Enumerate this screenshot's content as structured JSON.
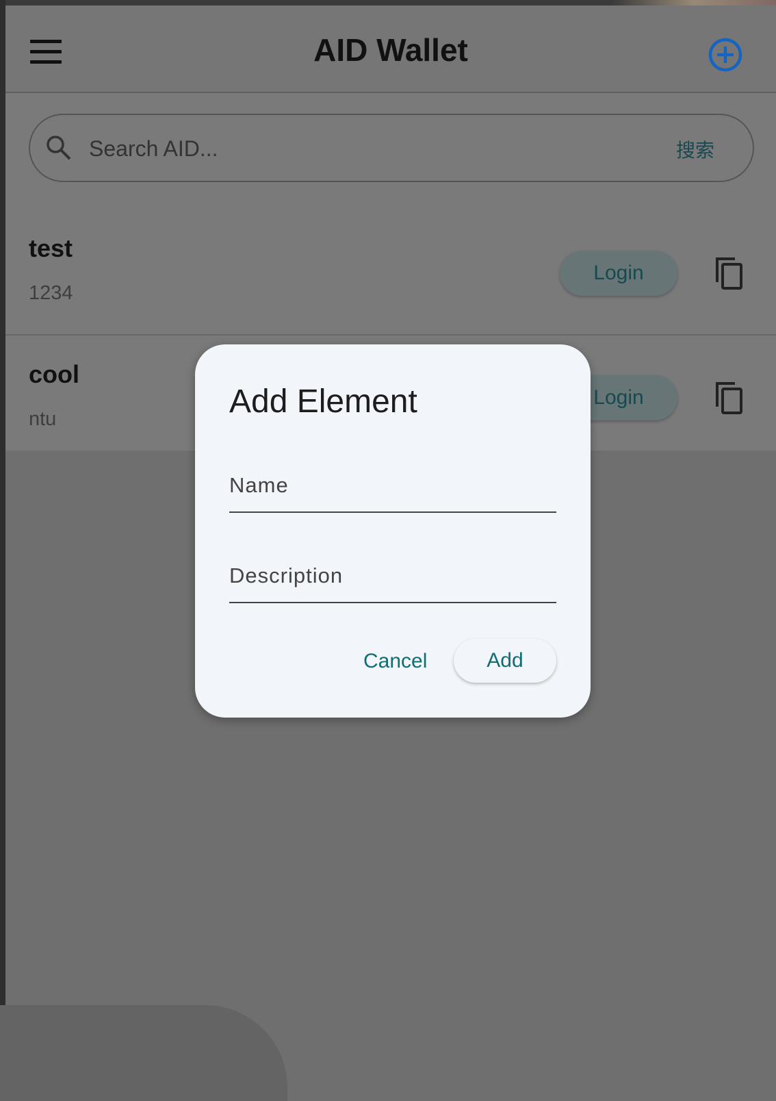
{
  "appbar": {
    "title": "AID Wallet",
    "menu_icon": "hamburger-menu-icon",
    "add_icon": "add-circle-icon",
    "accent_color": "#1565c0"
  },
  "search": {
    "placeholder": "Search AID...",
    "button_label": "搜索",
    "icon": "search-icon"
  },
  "items": [
    {
      "name": "test",
      "description": "1234",
      "login_label": "Login",
      "copy_icon": "copy-icon"
    },
    {
      "name": "cool",
      "description": "ntu",
      "login_label": "Login",
      "copy_icon": "copy-icon"
    }
  ],
  "dialog": {
    "title": "Add Element",
    "name_placeholder": "Name",
    "description_placeholder": "Description",
    "cancel_label": "Cancel",
    "add_label": "Add"
  },
  "colors": {
    "scrim": "#6f6f6f",
    "dialog_bg": "#f2f5f9",
    "action_text": "#0f6e74"
  }
}
